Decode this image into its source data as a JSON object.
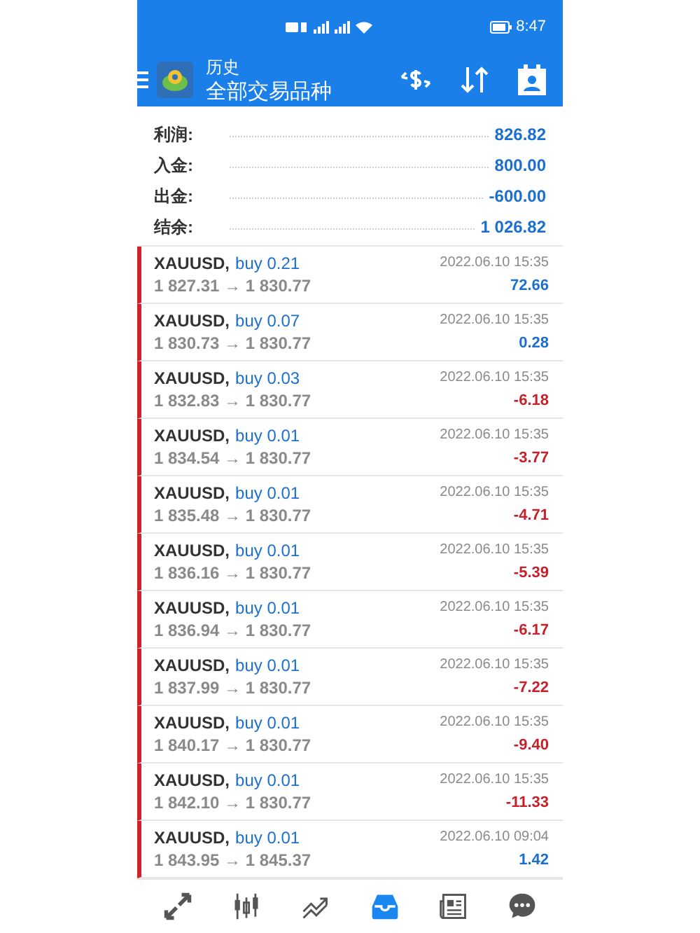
{
  "status_bar": {
    "time": "8:47"
  },
  "toolbar": {
    "title": "历史",
    "subtitle": "全部交易品种"
  },
  "summary": [
    {
      "label": "利润:",
      "value": "826.82"
    },
    {
      "label": "入金:",
      "value": "800.00"
    },
    {
      "label": "出金:",
      "value": "-600.00"
    },
    {
      "label": "结余:",
      "value": "1 026.82"
    }
  ],
  "deals": [
    {
      "symbol": "XAUUSD,",
      "side": "buy 0.21",
      "prices": "1 827.31 → 1 830.77",
      "time": "2022.06.10 15:35",
      "profit": "72.66",
      "loss": false
    },
    {
      "symbol": "XAUUSD,",
      "side": "buy 0.07",
      "prices": "1 830.73 → 1 830.77",
      "time": "2022.06.10 15:35",
      "profit": "0.28",
      "loss": false
    },
    {
      "symbol": "XAUUSD,",
      "side": "buy 0.03",
      "prices": "1 832.83 → 1 830.77",
      "time": "2022.06.10 15:35",
      "profit": "-6.18",
      "loss": true
    },
    {
      "symbol": "XAUUSD,",
      "side": "buy 0.01",
      "prices": "1 834.54 → 1 830.77",
      "time": "2022.06.10 15:35",
      "profit": "-3.77",
      "loss": true
    },
    {
      "symbol": "XAUUSD,",
      "side": "buy 0.01",
      "prices": "1 835.48 → 1 830.77",
      "time": "2022.06.10 15:35",
      "profit": "-4.71",
      "loss": true
    },
    {
      "symbol": "XAUUSD,",
      "side": "buy 0.01",
      "prices": "1 836.16 → 1 830.77",
      "time": "2022.06.10 15:35",
      "profit": "-5.39",
      "loss": true
    },
    {
      "symbol": "XAUUSD,",
      "side": "buy 0.01",
      "prices": "1 836.94 → 1 830.77",
      "time": "2022.06.10 15:35",
      "profit": "-6.17",
      "loss": true
    },
    {
      "symbol": "XAUUSD,",
      "side": "buy 0.01",
      "prices": "1 837.99 → 1 830.77",
      "time": "2022.06.10 15:35",
      "profit": "-7.22",
      "loss": true
    },
    {
      "symbol": "XAUUSD,",
      "side": "buy 0.01",
      "prices": "1 840.17 → 1 830.77",
      "time": "2022.06.10 15:35",
      "profit": "-9.40",
      "loss": true
    },
    {
      "symbol": "XAUUSD,",
      "side": "buy 0.01",
      "prices": "1 842.10 → 1 830.77",
      "time": "2022.06.10 15:35",
      "profit": "-11.33",
      "loss": true
    },
    {
      "symbol": "XAUUSD,",
      "side": "buy 0.01",
      "prices": "1 843.95 → 1 845.37",
      "time": "2022.06.10 09:04",
      "profit": "1.42",
      "loss": false
    }
  ],
  "bottom_nav": [
    {
      "kind": "trade",
      "selected": false
    },
    {
      "kind": "chart",
      "selected": false
    },
    {
      "kind": "trend",
      "selected": false
    },
    {
      "kind": "history",
      "selected": true
    },
    {
      "kind": "news",
      "selected": false
    },
    {
      "kind": "chat",
      "selected": false
    }
  ]
}
